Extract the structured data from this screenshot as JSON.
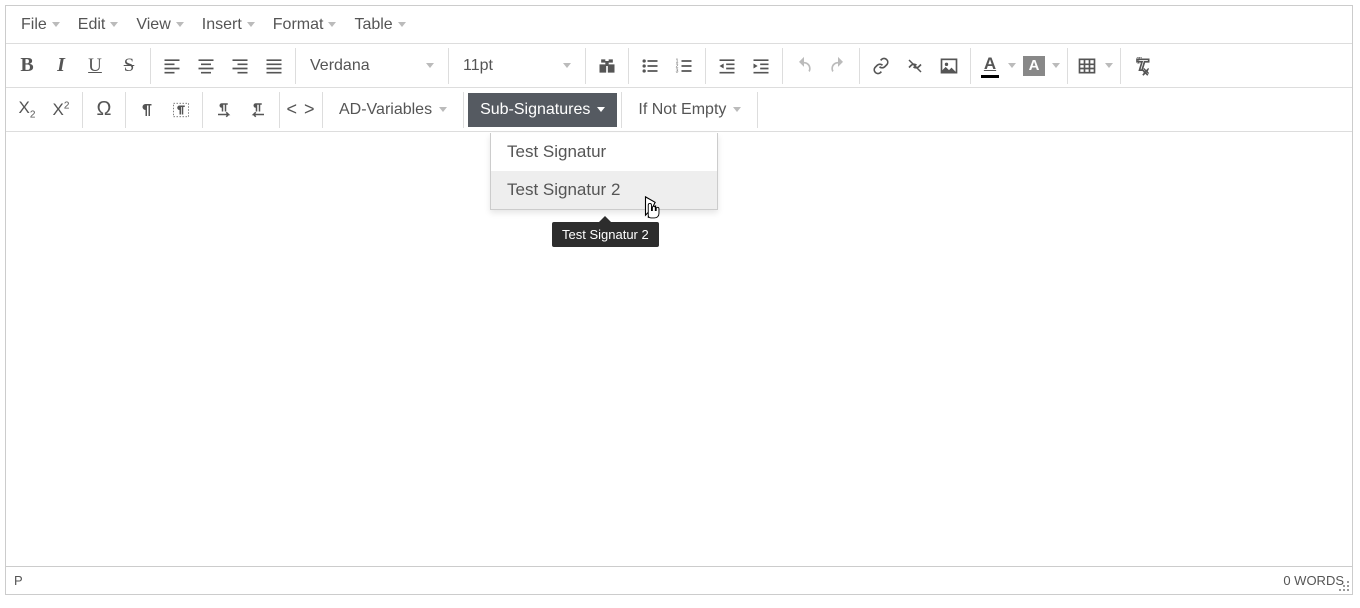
{
  "menubar": {
    "items": [
      "File",
      "Edit",
      "View",
      "Insert",
      "Format",
      "Table"
    ]
  },
  "toolbar1": {
    "font": "Verdana",
    "size": "11pt",
    "textcolor": "#000000",
    "bgcolor": "#888888"
  },
  "toolbar2": {
    "ad_variables_label": "AD-Variables",
    "sub_signatures_label": "Sub-Signatures",
    "if_not_empty_label": "If Not Empty"
  },
  "dropdown": {
    "items": [
      "Test Signatur",
      "Test Signatur 2"
    ],
    "hovered_index": 1
  },
  "tooltip": {
    "text": "Test Signatur 2"
  },
  "statusbar": {
    "path": "P",
    "words": "0 WORDS"
  }
}
